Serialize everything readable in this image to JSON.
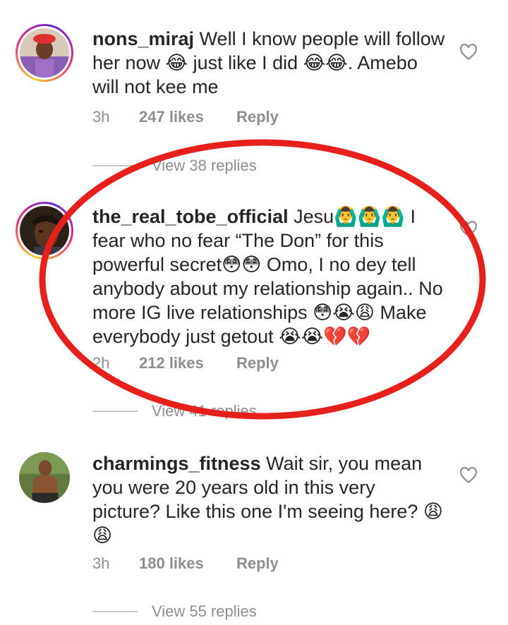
{
  "comments": [
    {
      "username": "nons_miraj",
      "text": "Well I know people will follow her now 😂 just like I did 😂😂. Amebo will not kee me",
      "time": "3h",
      "likes": "247 likes",
      "reply": "Reply",
      "view_replies": "View 38 replies"
    },
    {
      "username": "the_real_tobe_official",
      "text": "Jesu🙆‍♂️🙆‍♂️🙆‍♂️ I fear who no fear “The Don” for this powerful secret😳😳 Omo, I no dey tell anybody about my relationship again.. No more IG live relationships 😳😭😩 Make everybody just getout 😭😭💔💔",
      "time": "2h",
      "likes": "212 likes",
      "reply": "Reply",
      "view_replies": "View 41 replies"
    },
    {
      "username": "charmings_fitness",
      "text": "Wait sir, you mean you were 20 years old in this very picture?  Like this one I'm seeing here? 😩😩",
      "time": "3h",
      "likes": "180 likes",
      "reply": "Reply",
      "view_replies": "View 55 replies"
    }
  ],
  "colors": {
    "text": "#262626",
    "meta": "#8e8e8e",
    "annotation": "#e8201c"
  }
}
